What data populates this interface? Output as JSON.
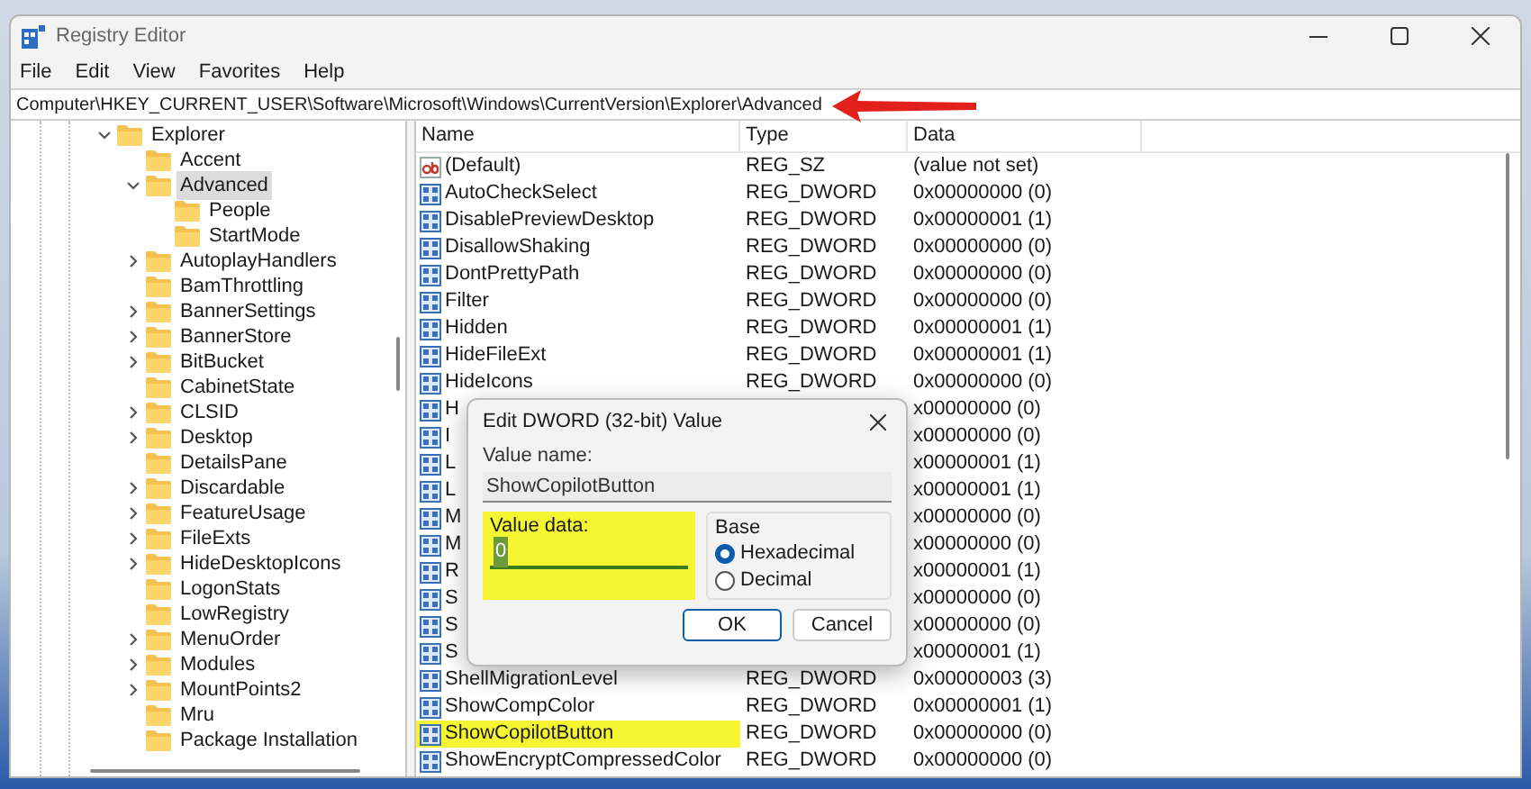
{
  "window": {
    "title": "Registry Editor"
  },
  "menu": [
    "File",
    "Edit",
    "View",
    "Favorites",
    "Help"
  ],
  "address": "Computer\\HKEY_CURRENT_USER\\Software\\Microsoft\\Windows\\CurrentVersion\\Explorer\\Advanced",
  "tree": [
    {
      "label": "Explorer",
      "expanded": true,
      "selected": false,
      "children": [
        {
          "label": "Accent",
          "selected": false
        },
        {
          "label": "Advanced",
          "expanded": true,
          "selected": true,
          "children": [
            {
              "label": "People",
              "selected": false
            },
            {
              "label": "StartMode",
              "selected": false
            }
          ]
        },
        {
          "label": "AutoplayHandlers",
          "expanded": false,
          "selected": false
        },
        {
          "label": "BamThrottling",
          "selected": false
        },
        {
          "label": "BannerSettings",
          "expanded": false,
          "selected": false
        },
        {
          "label": "BannerStore",
          "expanded": false,
          "selected": false
        },
        {
          "label": "BitBucket",
          "expanded": false,
          "selected": false
        },
        {
          "label": "CabinetState",
          "selected": false
        },
        {
          "label": "CLSID",
          "expanded": false,
          "selected": false
        },
        {
          "label": "Desktop",
          "expanded": false,
          "selected": false
        },
        {
          "label": "DetailsPane",
          "selected": false
        },
        {
          "label": "Discardable",
          "expanded": false,
          "selected": false
        },
        {
          "label": "FeatureUsage",
          "expanded": false,
          "selected": false
        },
        {
          "label": "FileExts",
          "expanded": false,
          "selected": false
        },
        {
          "label": "HideDesktopIcons",
          "expanded": false,
          "selected": false
        },
        {
          "label": "LogonStats",
          "selected": false
        },
        {
          "label": "LowRegistry",
          "selected": false
        },
        {
          "label": "MenuOrder",
          "expanded": false,
          "selected": false
        },
        {
          "label": "Modules",
          "expanded": false,
          "selected": false
        },
        {
          "label": "MountPoints2",
          "expanded": false,
          "selected": false
        },
        {
          "label": "Mru",
          "selected": false
        },
        {
          "label": "Package Installation",
          "selected": false
        }
      ]
    }
  ],
  "columns": [
    "Name",
    "Type",
    "Data"
  ],
  "values": [
    {
      "kind": "string",
      "name": "(Default)",
      "type": "REG_SZ",
      "data": "(value not set)",
      "highlighted": false
    },
    {
      "kind": "dword",
      "name": "AutoCheckSelect",
      "type": "REG_DWORD",
      "data": "0x00000000 (0)",
      "highlighted": false
    },
    {
      "kind": "dword",
      "name": "DisablePreviewDesktop",
      "type": "REG_DWORD",
      "data": "0x00000001 (1)",
      "highlighted": false
    },
    {
      "kind": "dword",
      "name": "DisallowShaking",
      "type": "REG_DWORD",
      "data": "0x00000000 (0)",
      "highlighted": false
    },
    {
      "kind": "dword",
      "name": "DontPrettyPath",
      "type": "REG_DWORD",
      "data": "0x00000000 (0)",
      "highlighted": false
    },
    {
      "kind": "dword",
      "name": "Filter",
      "type": "REG_DWORD",
      "data": "0x00000000 (0)",
      "highlighted": false
    },
    {
      "kind": "dword",
      "name": "Hidden",
      "type": "REG_DWORD",
      "data": "0x00000001 (1)",
      "highlighted": false
    },
    {
      "kind": "dword",
      "name": "HideFileExt",
      "type": "REG_DWORD",
      "data": "0x00000001 (1)",
      "highlighted": false
    },
    {
      "kind": "dword",
      "name": "HideIcons",
      "type": "REG_DWORD",
      "data": "0x00000000 (0)",
      "highlighted": false
    },
    {
      "kind": "dword",
      "name": "H",
      "data": "x00000000 (0)",
      "highlighted": false
    },
    {
      "kind": "dword",
      "name": "I",
      "data": "x00000000 (0)",
      "highlighted": false
    },
    {
      "kind": "dword",
      "name": "L",
      "data": "x00000001 (1)",
      "highlighted": false
    },
    {
      "kind": "dword",
      "name": "L",
      "data": "x00000001 (1)",
      "highlighted": false
    },
    {
      "kind": "dword",
      "name": "M",
      "data": "x00000000 (0)",
      "highlighted": false
    },
    {
      "kind": "dword",
      "name": "M",
      "data": "x00000000 (0)",
      "highlighted": false
    },
    {
      "kind": "dword",
      "name": "R",
      "data": "x00000001 (1)",
      "highlighted": false
    },
    {
      "kind": "dword",
      "name": "S",
      "data": "x00000000 (0)",
      "highlighted": false
    },
    {
      "kind": "dword",
      "name": "S",
      "data": "x00000000 (0)",
      "highlighted": false
    },
    {
      "kind": "dword",
      "name": "S",
      "data": "x00000001 (1)",
      "highlighted": false
    },
    {
      "kind": "dword",
      "name": "ShellMigrationLevel",
      "type": "REG_DWORD",
      "data": "0x00000003 (3)",
      "highlighted": false
    },
    {
      "kind": "dword",
      "name": "ShowCompColor",
      "type": "REG_DWORD",
      "data": "0x00000001 (1)",
      "highlighted": false
    },
    {
      "kind": "dword",
      "name": "ShowCopilotButton",
      "type": "REG_DWORD",
      "data": "0x00000000 (0)",
      "highlighted": true
    },
    {
      "kind": "dword",
      "name": "ShowEncryptCompressedColor",
      "type": "REG_DWORD",
      "data": "0x00000000 (0)",
      "highlighted": false
    }
  ],
  "dialog": {
    "title": "Edit DWORD (32-bit) Value",
    "value_name_label": "Value name:",
    "value_name": "ShowCopilotButton",
    "value_data_label": "Value data:",
    "value_data": "0",
    "value_data_highlighted": true,
    "base_label": "Base",
    "base_options": [
      {
        "label": "Hexadecimal",
        "selected": true
      },
      {
        "label": "Decimal",
        "selected": false
      }
    ],
    "buttons": [
      "OK",
      "Cancel"
    ]
  }
}
